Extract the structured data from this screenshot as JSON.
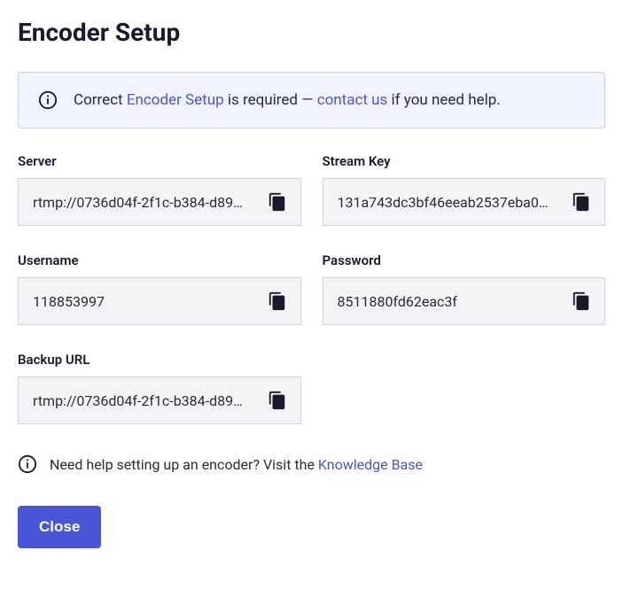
{
  "title": "Encoder Setup",
  "banner": {
    "before": "Correct ",
    "link1": "Encoder Setup",
    "mid": " is required — ",
    "link2": "contact us",
    "after": " if you need help."
  },
  "fields": {
    "server": {
      "label": "Server",
      "value": "rtmp://0736d04f-2f1c-b384-d89…"
    },
    "streamKey": {
      "label": "Stream Key",
      "value": "131a743dc3bf46eeab2537eba0…"
    },
    "username": {
      "label": "Username",
      "value": "118853997"
    },
    "password": {
      "label": "Password",
      "value": "8511880fd62eac3f"
    },
    "backupUrl": {
      "label": "Backup URL",
      "value": "rtmp://0736d04f-2f1c-b384-d89…"
    }
  },
  "help": {
    "before": "Need help setting up an encoder? Visit the ",
    "link": "Knowledge Base"
  },
  "closeLabel": "Close"
}
